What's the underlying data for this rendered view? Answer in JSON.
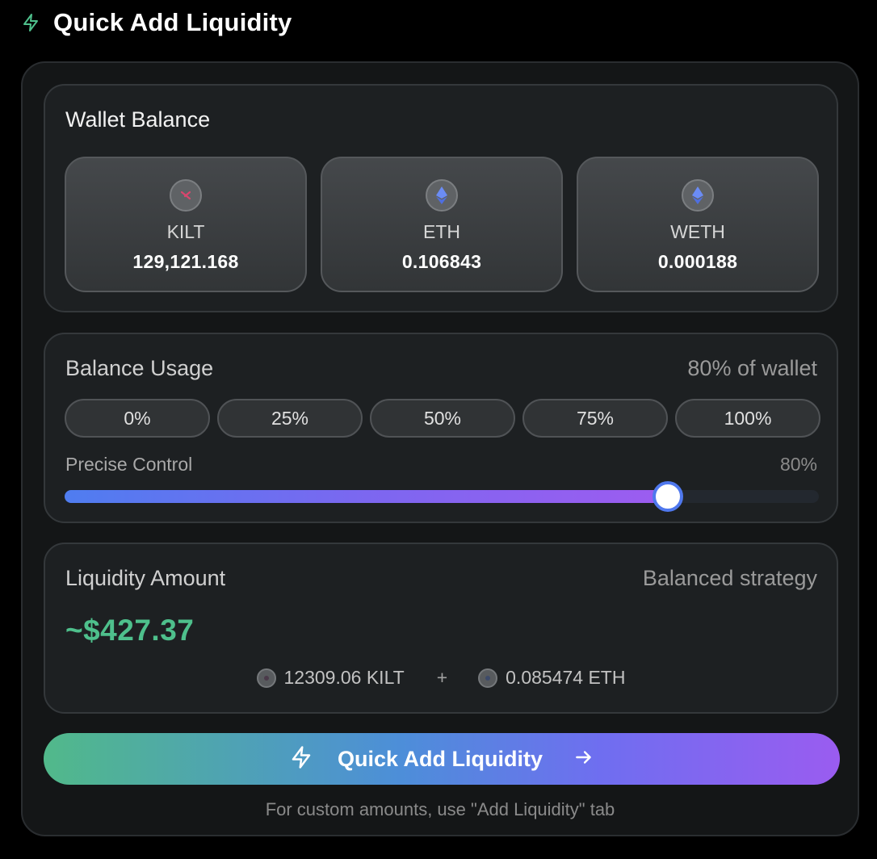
{
  "header": {
    "title": "Quick Add Liquidity",
    "icon": "bolt-icon",
    "accent": "#4ec08c"
  },
  "wallet": {
    "title": "Wallet Balance",
    "tokens": [
      {
        "name": "KILT",
        "value": "129,121.168",
        "icon": "kilt-icon"
      },
      {
        "name": "ETH",
        "value": "0.106843",
        "icon": "ethereum-icon"
      },
      {
        "name": "WETH",
        "value": "0.000188",
        "icon": "ethereum-icon"
      }
    ]
  },
  "usage": {
    "title": "Balance Usage",
    "summary": "80% of wallet",
    "presets": [
      "0%",
      "25%",
      "50%",
      "75%",
      "100%"
    ],
    "precise_label": "Precise Control",
    "precise_value": "80%",
    "slider_percent": 80
  },
  "amount": {
    "title": "Liquidity Amount",
    "strategy": "Balanced strategy",
    "usd": "~$427.37",
    "kilt": "12309.06 KILT",
    "plus": "+",
    "eth": "0.085474 ETH"
  },
  "cta": {
    "label": "Quick Add Liquidity"
  },
  "hint": "For custom amounts, use \"Add Liquidity\" tab"
}
